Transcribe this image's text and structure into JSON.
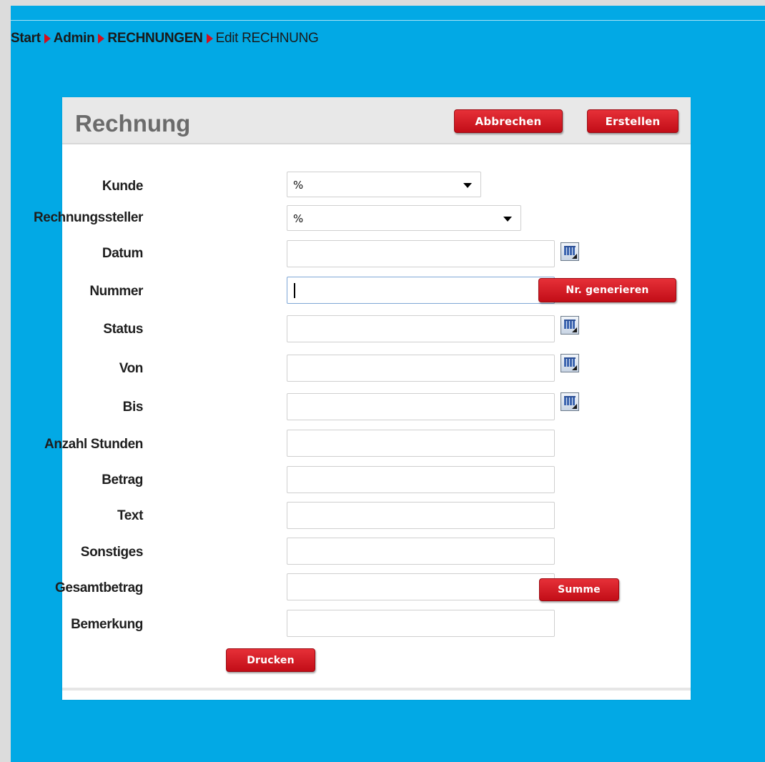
{
  "breadcrumb": {
    "items": [
      "Start",
      "Admin",
      "RECHNUNGEN"
    ],
    "current": "Edit RECHNUNG"
  },
  "panel": {
    "title": "Rechnung",
    "cancel_label": "Abbrechen",
    "create_label": "Erstellen"
  },
  "form": {
    "kunde": {
      "label": "Kunde",
      "value": "%"
    },
    "rechnungssteller": {
      "label": "Rechnungssteller",
      "value": "%"
    },
    "datum": {
      "label": "Datum",
      "value": ""
    },
    "nummer": {
      "label": "Nummer",
      "value": "",
      "button": "Nr. generieren"
    },
    "status": {
      "label": "Status",
      "value": ""
    },
    "von": {
      "label": "Von",
      "value": ""
    },
    "bis": {
      "label": "Bis",
      "value": ""
    },
    "anzahl_stunden": {
      "label": "Anzahl Stunden",
      "value": ""
    },
    "betrag": {
      "label": "Betrag",
      "value": ""
    },
    "text": {
      "label": "Text",
      "value": ""
    },
    "sonstiges": {
      "label": "Sonstiges",
      "value": ""
    },
    "gesamtbetrag": {
      "label": "Gesamtbetrag",
      "value": "",
      "button": "Summe"
    },
    "bemerkung": {
      "label": "Bemerkung",
      "value": ""
    },
    "print_label": "Drucken"
  },
  "icons": {
    "breadcrumb_separator": "triangle-right-icon",
    "calendar": "calendar-icon",
    "dropdown": "chevron-down-icon"
  },
  "colors": {
    "background": "#02a9e5",
    "button": "#d0121c",
    "breadcrumb_arrow": "#d30f1e"
  }
}
